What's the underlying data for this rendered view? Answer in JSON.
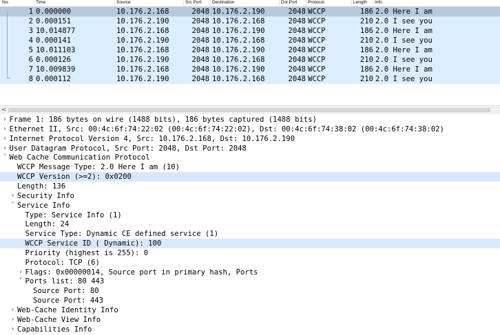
{
  "columns": {
    "no": "No.",
    "time": "Time",
    "source": "Source",
    "src_port": "Src Port",
    "destination": "Destination",
    "dst_port": "Dst Port",
    "protocol": "Protocol",
    "length": "Length",
    "info": "Info"
  },
  "packets": [
    {
      "no": "1",
      "time": "0.000000",
      "source": "10.176.2.168",
      "src_port": "2048",
      "destination": "10.176.2.190",
      "dst_port": "2048",
      "protocol": "WCCP",
      "length": "186",
      "info": "2.0 Here I am"
    },
    {
      "no": "2",
      "time": "0.000151",
      "source": "10.176.2.190",
      "src_port": "2048",
      "destination": "10.176.2.168",
      "dst_port": "2048",
      "protocol": "WCCP",
      "length": "210",
      "info": "2.0 I see you"
    },
    {
      "no": "3",
      "time": "10.014877",
      "source": "10.176.2.168",
      "src_port": "2048",
      "destination": "10.176.2.190",
      "dst_port": "2048",
      "protocol": "WCCP",
      "length": "186",
      "info": "2.0 Here I am"
    },
    {
      "no": "4",
      "time": "0.000141",
      "source": "10.176.2.190",
      "src_port": "2048",
      "destination": "10.176.2.168",
      "dst_port": "2048",
      "protocol": "WCCP",
      "length": "210",
      "info": "2.0 I see you"
    },
    {
      "no": "5",
      "time": "10.011103",
      "source": "10.176.2.168",
      "src_port": "2048",
      "destination": "10.176.2.190",
      "dst_port": "2048",
      "protocol": "WCCP",
      "length": "186",
      "info": "2.0 Here I am"
    },
    {
      "no": "6",
      "time": "0.000126",
      "source": "10.176.2.190",
      "src_port": "2048",
      "destination": "10.176.2.168",
      "dst_port": "2048",
      "protocol": "WCCP",
      "length": "210",
      "info": "2.0 I see you"
    },
    {
      "no": "7",
      "time": "10.009839",
      "source": "10.176.2.168",
      "src_port": "2048",
      "destination": "10.176.2.190",
      "dst_port": "2048",
      "protocol": "WCCP",
      "length": "186",
      "info": "2.0 Here I am"
    },
    {
      "no": "8",
      "time": "0.000112",
      "source": "10.176.2.190",
      "src_port": "2048",
      "destination": "10.176.2.168",
      "dst_port": "2048",
      "protocol": "WCCP",
      "length": "210",
      "info": "2.0 I see you"
    }
  ],
  "selected_packet": "1",
  "details": [
    {
      "level": 0,
      "toggle": "collapsed",
      "text": "Frame 1: 186 bytes on wire (1488 bits), 186 bytes captured (1488 bits)"
    },
    {
      "level": 0,
      "toggle": "collapsed",
      "text": "Ethernet II, Src: 00:4c:6f:74:22:02 (00:4c:6f:74:22:02), Dst: 00:4c:6f:74:38:02 (00:4c:6f:74:38:02)"
    },
    {
      "level": 0,
      "toggle": "collapsed",
      "text": "Internet Protocol Version 4, Src: 10.176.2.168, Dst: 10.176.2.190"
    },
    {
      "level": 0,
      "toggle": "collapsed",
      "text": "User Datagram Protocol, Src Port: 2048, Dst Port: 2048"
    },
    {
      "level": 0,
      "toggle": "expanded",
      "text": "Web Cache Communication Protocol"
    },
    {
      "level": 1,
      "toggle": "none",
      "text": "WCCP Message Type: 2.0 Here I am (10)"
    },
    {
      "level": 1,
      "toggle": "none",
      "text": "WCCP Version (>=2): 0x0200",
      "highlight": true
    },
    {
      "level": 1,
      "toggle": "none",
      "text": "Length: 136"
    },
    {
      "level": 1,
      "toggle": "collapsed",
      "text": "Security Info"
    },
    {
      "level": 1,
      "toggle": "expanded",
      "text": "Service Info"
    },
    {
      "level": 2,
      "toggle": "none",
      "text": "Type: Service Info (1)"
    },
    {
      "level": 2,
      "toggle": "none",
      "text": "Length: 24"
    },
    {
      "level": 2,
      "toggle": "none",
      "text": "Service Type: Dynamic CE defined service (1)"
    },
    {
      "level": 2,
      "toggle": "none",
      "text": "WCCP Service ID ( Dynamic): 100",
      "highlight": true
    },
    {
      "level": 2,
      "toggle": "none",
      "text": "Priority (highest is 255): 0"
    },
    {
      "level": 2,
      "toggle": "none",
      "text": "Protocol: TCP (6)"
    },
    {
      "level": 2,
      "toggle": "collapsed",
      "text": "Flags: 0x00000014, Source port in primary hash, Ports"
    },
    {
      "level": 2,
      "toggle": "expanded",
      "text": "Ports list:  80 443"
    },
    {
      "level": 3,
      "toggle": "none",
      "text": "Source Port: 80"
    },
    {
      "level": 3,
      "toggle": "none",
      "text": "Source Port: 443"
    },
    {
      "level": 1,
      "toggle": "collapsed",
      "text": "Web-Cache Identity Info"
    },
    {
      "level": 1,
      "toggle": "collapsed",
      "text": "Web-Cache View Info"
    },
    {
      "level": 1,
      "toggle": "collapsed",
      "text": "Capabilities Info"
    }
  ],
  "icons": {
    "collapsed": "chevron-right-icon",
    "expanded": "chevron-down-icon",
    "scroll_left": "scroll-left-arrow-icon"
  },
  "colors": {
    "row_bg": "#dbeeff",
    "row_selected_bg": "#b7c9dd",
    "detail_highlight_bg": "#d7e8fb"
  }
}
